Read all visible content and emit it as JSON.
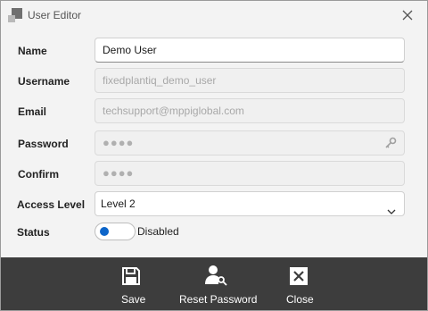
{
  "window": {
    "title": "User Editor",
    "app_icon": "window-app-icon",
    "close_icon": "close-icon"
  },
  "form": {
    "name": {
      "label": "Name",
      "value": "Demo User"
    },
    "username": {
      "label": "Username",
      "placeholder": "fixedplantiq_demo_user"
    },
    "email": {
      "label": "Email",
      "placeholder": "techsupport@mppiglobal.com"
    },
    "password": {
      "label": "Password",
      "placeholder": "●●●●",
      "icon": "key-icon"
    },
    "confirm": {
      "label": "Confirm",
      "placeholder": "●●●●"
    },
    "access_level": {
      "label": "Access Level",
      "value": "Level 2",
      "icon": "chevron-down-icon"
    },
    "status": {
      "label": "Status",
      "value": "Disabled",
      "enabled": false
    }
  },
  "toolbar": {
    "save_label": "Save",
    "save_icon": "save-icon",
    "reset_label": "Reset Password",
    "reset_icon": "user-key-icon",
    "close_label": "Close",
    "close_icon": "close-box-icon"
  },
  "colors": {
    "toolbar_bg": "#3d3d3d",
    "accent": "#0c65c9",
    "dialog_bg": "#f3f3f3"
  }
}
